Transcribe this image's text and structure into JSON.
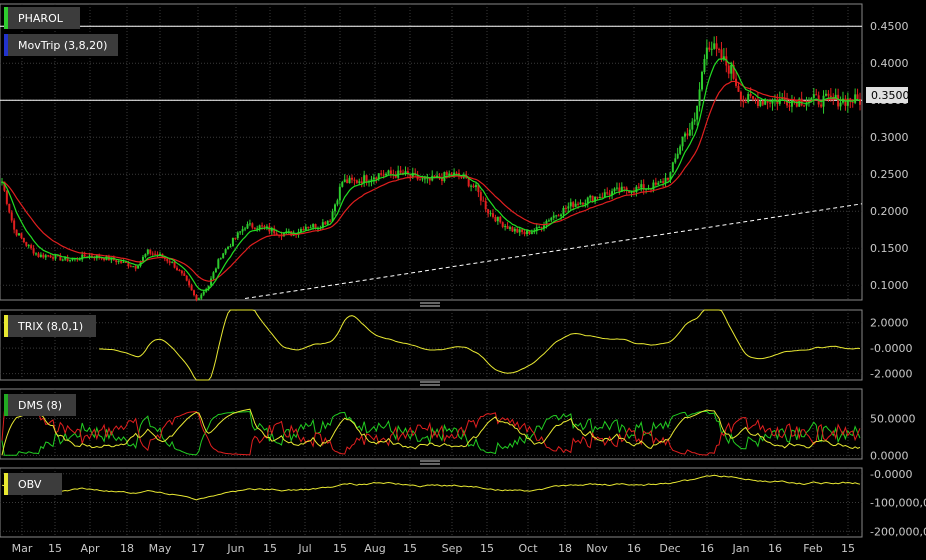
{
  "title": "PHAROL",
  "indicator_labels": {
    "main_overlay": "MovTrip (3,8,20)",
    "trix": "TRIX (8,0,1)",
    "dms": "DMS (8)",
    "obv": "OBV"
  },
  "colors": {
    "background": "#000000",
    "grid": "#3a3a3a",
    "axis_text": "#c8c8c8",
    "up_candle": "#2ecc2e",
    "down_candle": "#e01f1f",
    "ma_short": "#22dd22",
    "ma_long": "#e01f1f",
    "trendline": "#ffffff",
    "trix": "#e8e832",
    "dms_plus": "#22cc22",
    "dms_minus": "#e01f1f",
    "dms_adx": "#e8e832",
    "obv": "#e8e832",
    "label_bg": "#3c3c3c",
    "price_tag_bg": "#e0e0e0"
  },
  "chart_data": [
    {
      "type": "line",
      "panel": "price",
      "title": "PHAROL",
      "y_ticks": [
        "0.4500",
        "0.4000",
        "0.3500",
        "0.3000",
        "0.2500",
        "0.2000",
        "0.1500",
        "0.1000"
      ],
      "ylim": [
        0.08,
        0.48
      ],
      "last_price_label": "0.3500",
      "x_tick_labels": [
        "Mar",
        "15",
        "Apr",
        "18",
        "May",
        "17",
        "Jun",
        "15",
        "Jul",
        "15",
        "Aug",
        "15",
        "Sep",
        "15",
        "Oct",
        "18",
        "Nov",
        "16",
        "Dec",
        "16",
        "Jan",
        "16",
        "Feb",
        "15"
      ],
      "series": [
        {
          "name": "close",
          "x": [
            0,
            5,
            10,
            15,
            20,
            25,
            30,
            35,
            40,
            45,
            50,
            55,
            60,
            65,
            70,
            75,
            80,
            85,
            90,
            95,
            100,
            105,
            110,
            115,
            120,
            125,
            130,
            135,
            140,
            145,
            150,
            155,
            160,
            165,
            170,
            175,
            180,
            185,
            190,
            195,
            200,
            205,
            210,
            215,
            220,
            225,
            230,
            235,
            240,
            245,
            250,
            255,
            260,
            265,
            270,
            275,
            280,
            285,
            290,
            295,
            300,
            305,
            310,
            315,
            320,
            325,
            330,
            335,
            340,
            345,
            350,
            353
          ],
          "values": [
            0.24,
            0.175,
            0.155,
            0.14,
            0.14,
            0.135,
            0.135,
            0.14,
            0.138,
            0.135,
            0.13,
            0.125,
            0.145,
            0.14,
            0.13,
            0.11,
            0.08,
            0.1,
            0.14,
            0.16,
            0.18,
            0.18,
            0.175,
            0.17,
            0.17,
            0.18,
            0.18,
            0.19,
            0.24,
            0.24,
            0.245,
            0.25,
            0.25,
            0.25,
            0.245,
            0.24,
            0.245,
            0.25,
            0.245,
            0.23,
            0.2,
            0.185,
            0.175,
            0.17,
            0.175,
            0.19,
            0.2,
            0.21,
            0.215,
            0.22,
            0.225,
            0.228,
            0.23,
            0.232,
            0.235,
            0.25,
            0.3,
            0.32,
            0.43,
            0.41,
            0.39,
            0.35,
            0.35,
            0.35,
            0.35,
            0.35,
            0.35,
            0.35,
            0.35,
            0.35,
            0.35,
            0.35
          ]
        }
      ]
    },
    {
      "type": "line",
      "panel": "trix",
      "y_ticks": [
        "2.0000",
        "-0.0000",
        "-2.0000"
      ],
      "ylim": [
        -2.5,
        3.0
      ]
    },
    {
      "type": "line",
      "panel": "dms",
      "y_ticks": [
        "50.0000",
        "0.0000"
      ],
      "ylim": [
        -5,
        90
      ]
    },
    {
      "type": "line",
      "panel": "obv",
      "y_ticks": [
        "-0.0000",
        "-100,000,000",
        "-200,000,000"
      ],
      "ylim": [
        -220000000,
        20000000
      ]
    }
  ]
}
